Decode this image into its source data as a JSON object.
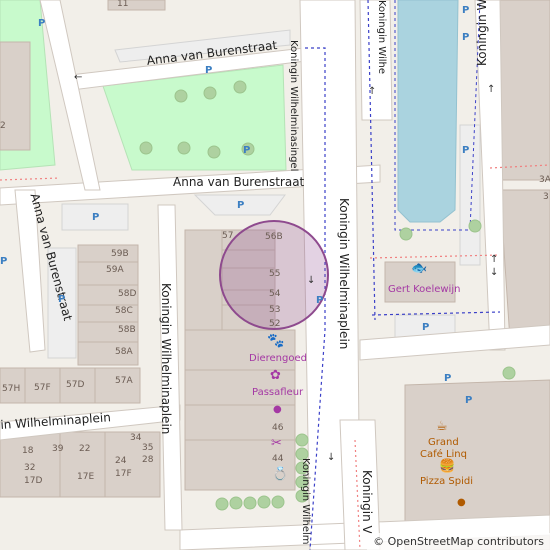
{
  "streets": {
    "anna_top": "Anna van Burenstraat",
    "anna_mid": "Anna van Burenstraat",
    "anna_left": "Anna van Burenstraat",
    "kw_singel": "Koningin Wilhelminasingel",
    "kw_plein": "Koningin Wilhelminaplein",
    "kw_plein_left": "Koningin Wilhelminaplein",
    "wilhelminaplein_left": "in Wilhelminaplein",
    "kw_top_a": "Koningin Wilhe",
    "kw_top_b": "Koningin W",
    "kw_bottom_a": "Koningin Wilhelm",
    "kw_bottom_b": "Koningin V"
  },
  "house_numbers": {
    "n11": "11",
    "n57": "57",
    "n56b": "56B",
    "n55": "55",
    "n54": "54",
    "n53": "53",
    "n52": "52",
    "n59b": "59B",
    "n59a": "59A",
    "n58d": "58D",
    "n58c": "58C",
    "n58b": "58B",
    "n58a": "58A",
    "n57h": "57H",
    "n57f": "57F",
    "n57d": "57D",
    "n57a": "57A",
    "n46": "46",
    "n44": "44",
    "n34": "34",
    "n18": "18",
    "n39": "39",
    "n22": "22",
    "n35": "35",
    "n28": "28",
    "n24": "24",
    "n32": "32",
    "n17d": "17D",
    "n17e": "17E",
    "n17f": "17F",
    "n2": "2",
    "n3a": "3A",
    "n3": "3"
  },
  "pois": {
    "dierengoed": "Dierengoed",
    "passafleur": "Passafleur",
    "gert_koelewijn": "Gert Koelewijn",
    "grand_cafe": "Grand\nCafé Linq",
    "grand": "Grand",
    "cafe_linq": "Café Linq",
    "pizza_spidi": "Pizza Spidi"
  },
  "parking_label": "P",
  "attribution": "© OpenStreetMap contributors",
  "colors": {
    "background": "#f2efe9",
    "road": "#ffffff",
    "building": "#d9d0c9",
    "building_outline": "#c4b6ab",
    "park": "#c8facc",
    "water": "#aad3df",
    "poi": "#a438a4",
    "food": "#b05a00",
    "parking_area": "#eeeeee",
    "selection": "#8e4a8e"
  }
}
